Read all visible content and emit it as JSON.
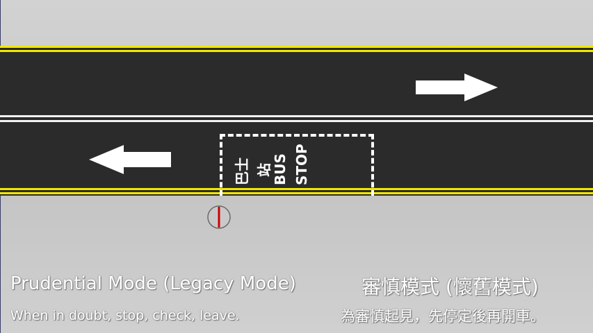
{
  "scene": {
    "bus_stop_marking": {
      "line_1": "巴士",
      "line_2": "站",
      "line_3": "BUS",
      "line_4": "STOP"
    }
  },
  "caption": {
    "title_en": "Prudential Mode (Legacy Mode)",
    "title_zh": "審慎模式 (懷舊模式)",
    "subtitle_en": "When in doubt, stop, check, leave.",
    "subtitle_zh": "為審慎起見，先停定後再開車。"
  },
  "colors": {
    "road": "#2b2b2b",
    "line_yellow": "#f2e600",
    "line_white": "#f4f4f4",
    "pavement": "#c8c8c8",
    "bus_stop_pole": "#d00000"
  }
}
